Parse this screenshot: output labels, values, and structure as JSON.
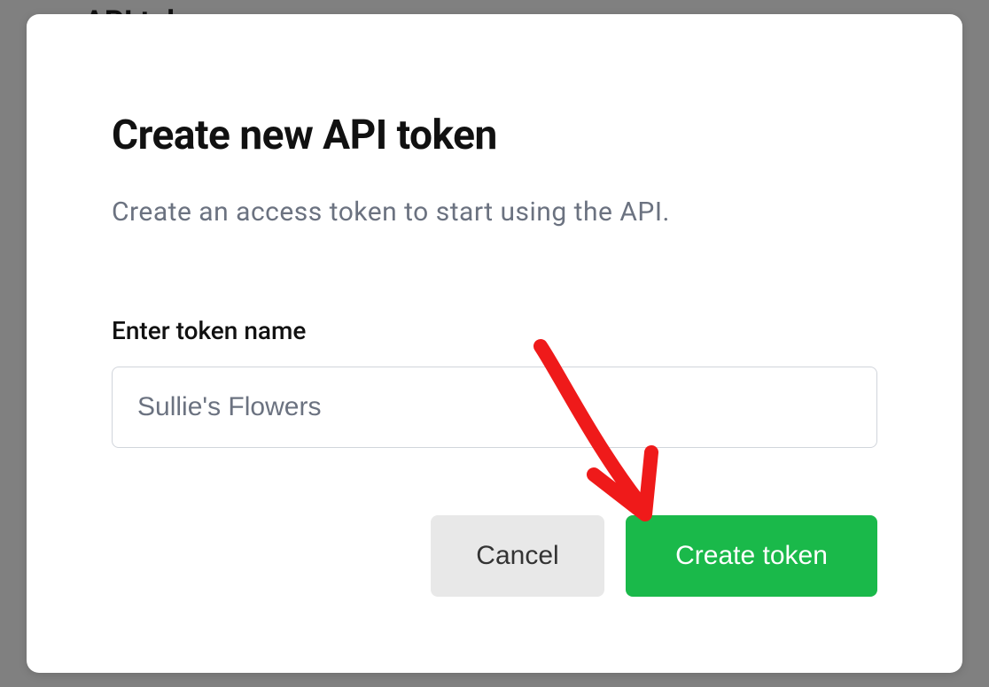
{
  "background": {
    "partial_text": "API tok"
  },
  "modal": {
    "title": "Create new API token",
    "subtitle": "Create an access token to start using the API.",
    "input_label": "Enter token name",
    "input_value": "Sullie's Flowers",
    "cancel_label": "Cancel",
    "create_label": "Create token"
  },
  "colors": {
    "primary_green": "#1ab94a",
    "annotation_red": "#ef1a1a"
  }
}
